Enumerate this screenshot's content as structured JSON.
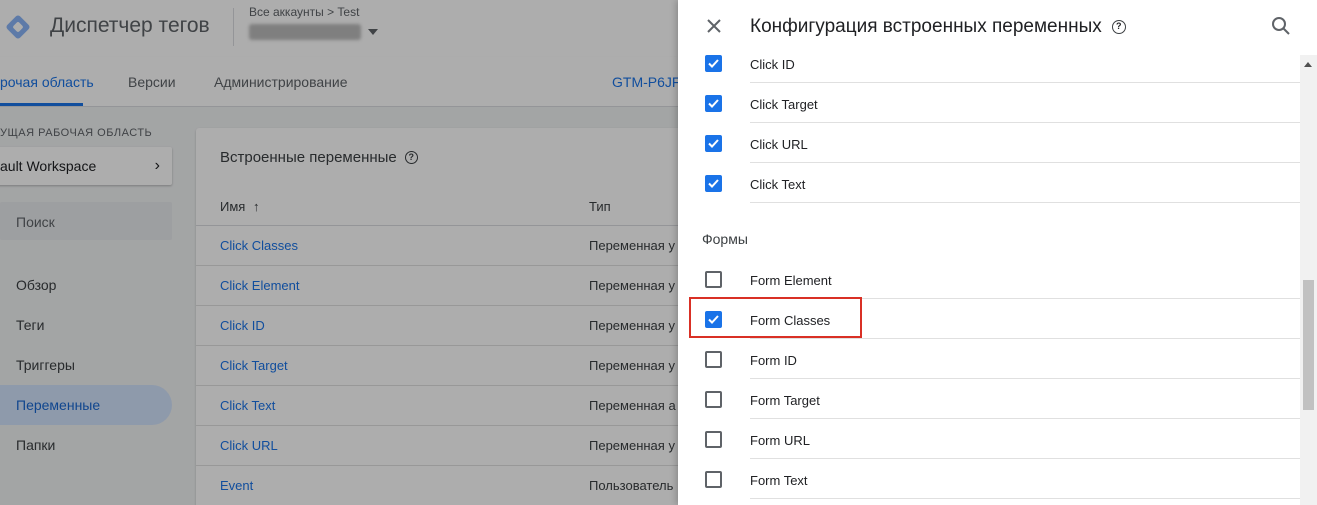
{
  "header": {
    "app_title": "Диспетчер тегов",
    "breadcrumb": "Все аккаунты > Test",
    "container_id": "GTM-P6JF"
  },
  "tabs": [
    {
      "label": "рочая область",
      "active": true
    },
    {
      "label": "Версии",
      "active": false
    },
    {
      "label": "Администрирование",
      "active": false
    }
  ],
  "sidebar": {
    "workspace_label": "УЩАЯ РАБОЧАЯ ОБЛАСТЬ",
    "workspace_name": "ault Workspace",
    "search_placeholder": "Поиск",
    "items": [
      {
        "label": "Обзор",
        "active": false
      },
      {
        "label": "Теги",
        "active": false
      },
      {
        "label": "Триггеры",
        "active": false
      },
      {
        "label": "Переменные",
        "active": true
      },
      {
        "label": "Папки",
        "active": false
      }
    ]
  },
  "table": {
    "title": "Встроенные переменные",
    "col_name": "Имя",
    "col_type": "Тип",
    "rows": [
      {
        "name": "Click Classes",
        "type": "Переменная у"
      },
      {
        "name": "Click Element",
        "type": "Переменная у"
      },
      {
        "name": "Click ID",
        "type": "Переменная у"
      },
      {
        "name": "Click Target",
        "type": "Переменная у"
      },
      {
        "name": "Click Text",
        "type": "Переменная а"
      },
      {
        "name": "Click URL",
        "type": "Переменная у"
      },
      {
        "name": "Event",
        "type": "Пользователь"
      }
    ]
  },
  "panel": {
    "title": "Конфигурация встроенных переменных",
    "clicks_items": [
      {
        "label": "Click ID",
        "checked": true
      },
      {
        "label": "Click Target",
        "checked": true
      },
      {
        "label": "Click URL",
        "checked": true
      },
      {
        "label": "Click Text",
        "checked": true
      }
    ],
    "forms_section": "Формы",
    "forms_items": [
      {
        "label": "Form Element",
        "checked": false
      },
      {
        "label": "Form Classes",
        "checked": true
      },
      {
        "label": "Form ID",
        "checked": false
      },
      {
        "label": "Form Target",
        "checked": false
      },
      {
        "label": "Form URL",
        "checked": false
      },
      {
        "label": "Form Text",
        "checked": false
      }
    ]
  },
  "colors": {
    "accent": "#1a73e8",
    "highlight": "#d93025"
  }
}
